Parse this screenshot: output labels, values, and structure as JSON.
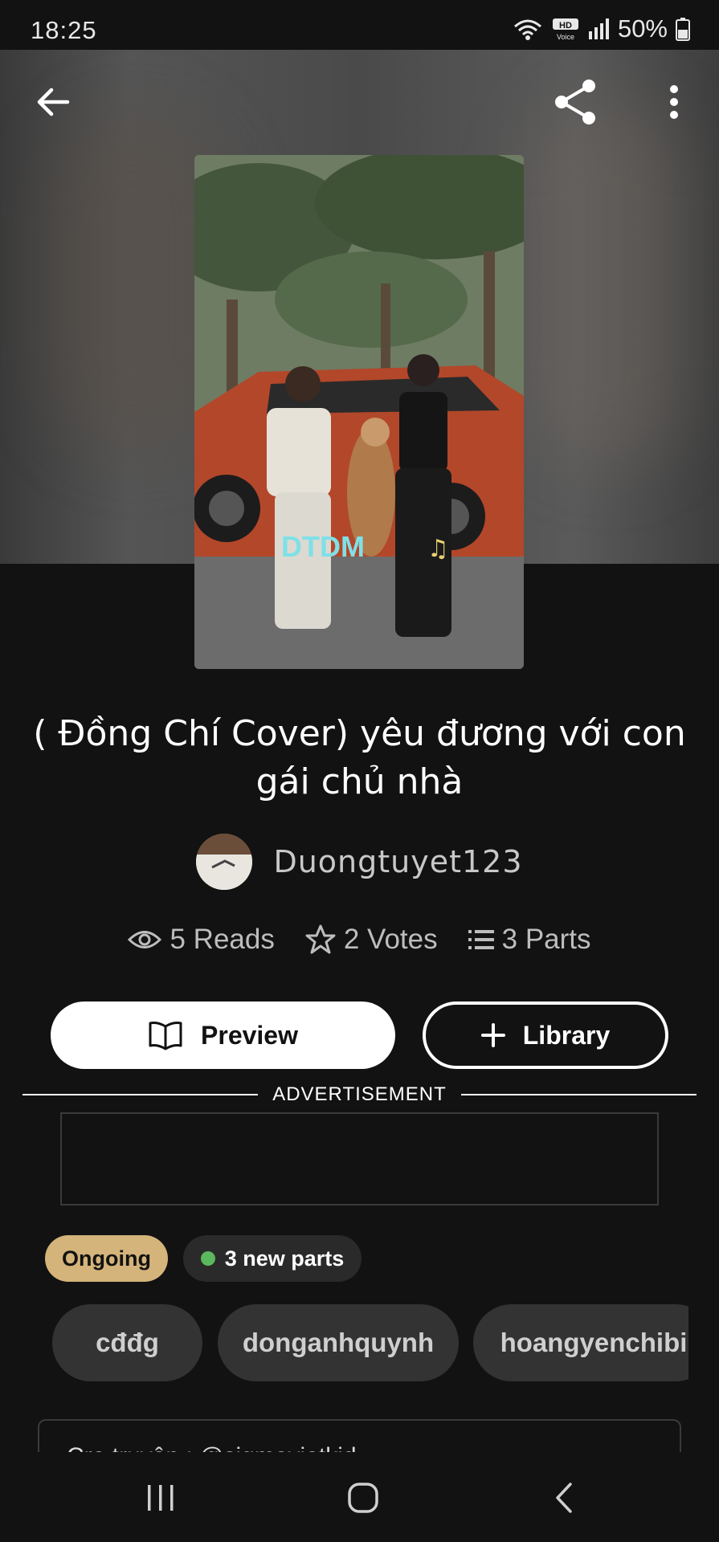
{
  "status_bar": {
    "time": "18:25",
    "battery": "50%",
    "icons": [
      "wifi-icon",
      "hd-voice-icon",
      "signal-icon",
      "battery-icon"
    ]
  },
  "top_bar": {
    "icons": [
      "back-arrow-icon",
      "share-icon",
      "more-vertical-icon"
    ]
  },
  "cover": {
    "overlay_text": "DTDM"
  },
  "story": {
    "title": "( Đồng Chí Cover) yêu đương với con gái chủ nhà",
    "author": "Duongtuyet123"
  },
  "stats": {
    "reads": "5 Reads",
    "votes": "2 Votes",
    "parts": "3 Parts"
  },
  "actions": {
    "preview_label": "Preview",
    "library_label": "Library"
  },
  "ad": {
    "label": "ADVERTISEMENT"
  },
  "status": {
    "label": "Ongoing",
    "new_parts": "3 new parts"
  },
  "tags": [
    "cđđg",
    "donganhquynh",
    "hoangyenchibi"
  ],
  "description": {
    "first_line": "Cre truyện : @sigmavietkid"
  },
  "colors": {
    "background": "#121212",
    "ongoing_pill": "#d4b47a",
    "new_dot": "#5cb85c",
    "tag_bg": "#333333"
  },
  "nav_bar": {
    "icons": [
      "recent-apps-icon",
      "home-icon",
      "back-icon"
    ]
  }
}
